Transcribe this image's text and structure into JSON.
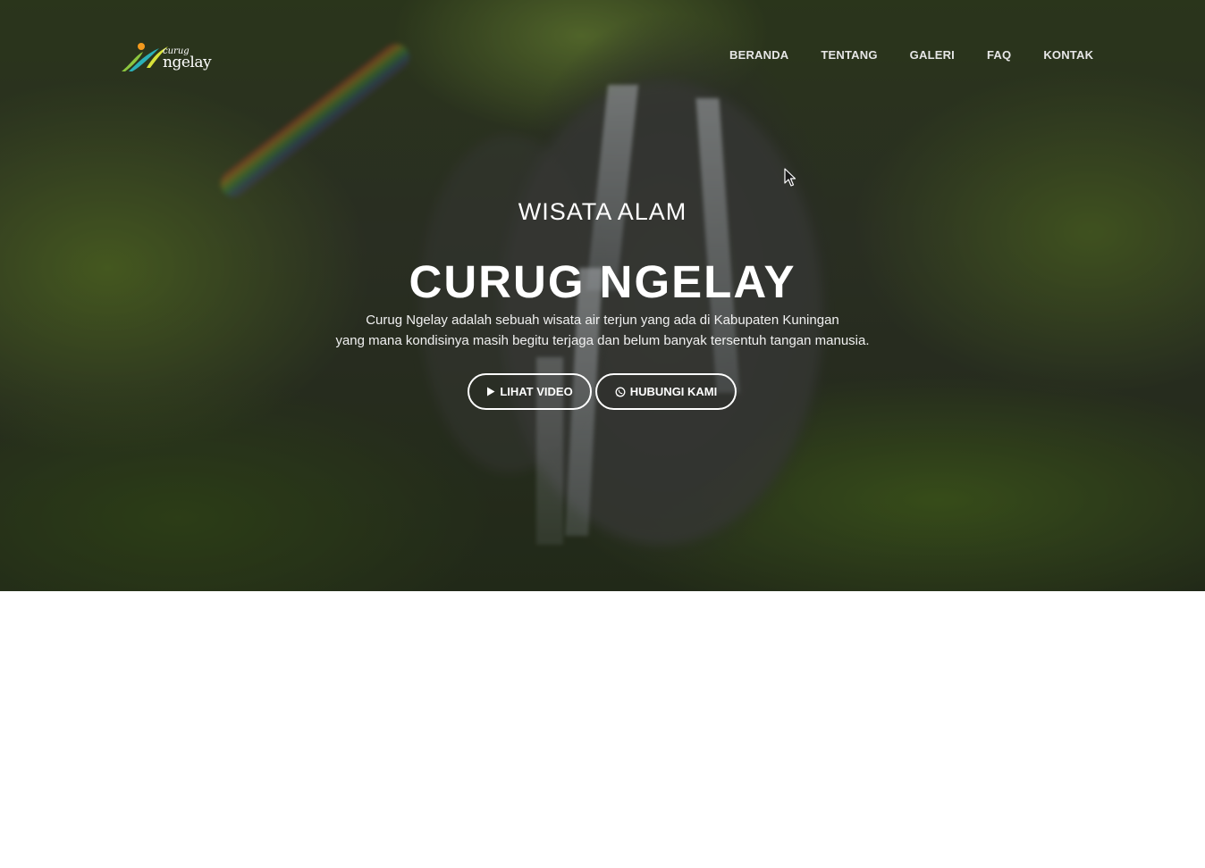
{
  "brand": {
    "logo_small": "curug",
    "logo_big": "ngelay"
  },
  "nav": {
    "items": [
      {
        "label": "BERANDA"
      },
      {
        "label": "TENTANG"
      },
      {
        "label": "GALERI"
      },
      {
        "label": "FAQ"
      },
      {
        "label": "KONTAK"
      }
    ]
  },
  "hero": {
    "eyebrow": "WISATA ALAM",
    "title": "CURUG NGELAY",
    "description_line1": "Curug Ngelay adalah sebuah wisata air terjun yang ada di Kabupaten Kuningan",
    "description_line2": "yang mana kondisinya masih begitu terjaga dan belum banyak tersentuh tangan manusia.",
    "buttons": {
      "video_label": "LIHAT VIDEO",
      "video_icon": "play-icon",
      "contact_label": "HUBUNGI KAMI",
      "contact_icon": "whatsapp-icon"
    }
  },
  "colors": {
    "text": "#ffffff",
    "nav_text": "#e7e7e7",
    "page_background": "#ffffff"
  }
}
